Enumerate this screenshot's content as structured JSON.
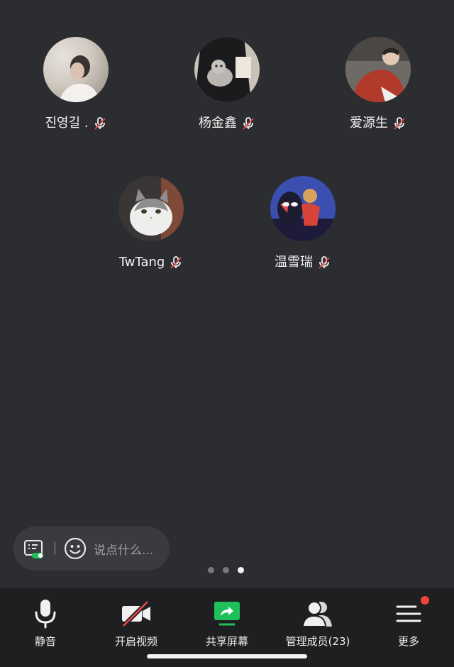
{
  "participants": [
    {
      "name": "진영길 .",
      "avatar": "person-side-profile",
      "muted": true
    },
    {
      "name": "杨金鑫",
      "avatar": "person-holding-cat",
      "muted": true
    },
    {
      "name": "爱源生",
      "avatar": "person-red-jacket",
      "muted": true
    },
    {
      "name": "TwTang",
      "avatar": "grey-white-kitten",
      "muted": true
    },
    {
      "name": "温雪瑞",
      "avatar": "spider-hero-cartoon",
      "muted": true
    }
  ],
  "chat": {
    "placeholder": "说点什么..."
  },
  "pager": {
    "count": 3,
    "active_index": 2
  },
  "toolbar": {
    "mute": "静音",
    "video": "开启视频",
    "share": "共享屏幕",
    "members": "管理成员(23)",
    "more": "更多"
  },
  "colors": {
    "background": "#2c2d30",
    "toolbar": "#1e1f21",
    "share_green": "#1fbf5b",
    "video_off_red": "#e04848",
    "badge_red": "#f0443a"
  }
}
